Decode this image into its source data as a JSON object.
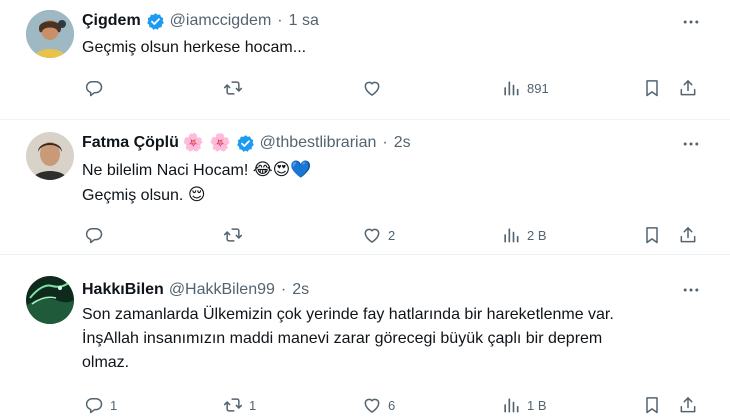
{
  "tweets": [
    {
      "name": "Çigdem",
      "handle": "@iamccigdem",
      "separator": "·",
      "time": "1 sa",
      "lines": [
        "Geçmiş olsun herkese hocam..."
      ],
      "stats": {
        "replies": "",
        "retweets": "",
        "likes": "",
        "views": "891"
      }
    },
    {
      "name": "Fatma Çöplü",
      "name_emojis": "🌸 🌸",
      "handle": "@thbestlibrarian",
      "separator": "·",
      "time": "2s",
      "line1_text": "Ne bilelim Naci Hocam!",
      "line1_emojis": "😂😍💙",
      "line2_text": "Geçmiş olsun.",
      "line2_emojis": "😌",
      "stats": {
        "replies": "",
        "retweets": "",
        "likes": "2",
        "views": "2 B"
      }
    },
    {
      "name": "HakkıBilen",
      "handle": "@HakkBilen99",
      "separator": "·",
      "time": "2s",
      "lines": [
        "Son zamanlarda Ülkemizin çok yerinde fay hatlarında bir hareketlenme var.",
        "İnşAllah insanımızın maddi manevi zarar görecegi büyük çaplı bir deprem",
        "olmaz."
      ],
      "stats": {
        "replies": "1",
        "retweets": "1",
        "likes": "6",
        "views": "1 B"
      }
    }
  ],
  "colors": {
    "text": "#0f1419",
    "muted": "#536471",
    "verified": "#1d9bf0",
    "divider": "#eff3f4"
  },
  "icons": [
    "reply-icon",
    "retweet-icon",
    "like-icon",
    "views-icon",
    "bookmark-icon",
    "share-icon",
    "more-icon",
    "verified-badge-icon"
  ]
}
